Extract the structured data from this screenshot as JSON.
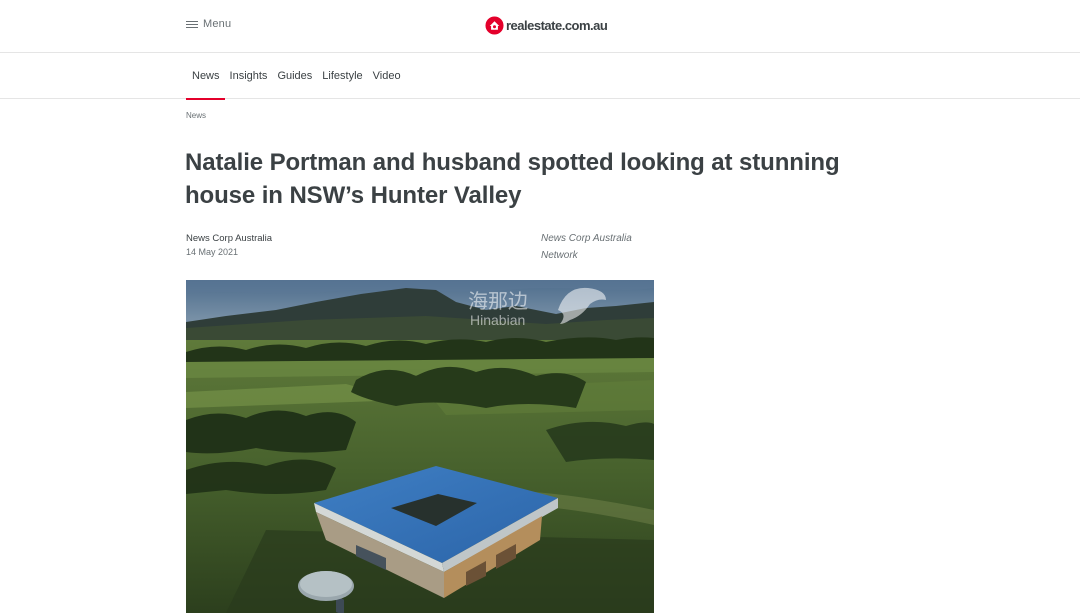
{
  "header": {
    "menu_label": "Menu",
    "logo_text": "realestate.com.au",
    "brand_color": "#e4002b"
  },
  "subnav": {
    "items": [
      {
        "label": "News",
        "active": true
      },
      {
        "label": "Insights",
        "active": false
      },
      {
        "label": "Guides",
        "active": false
      },
      {
        "label": "Lifestyle",
        "active": false
      },
      {
        "label": "Video",
        "active": false
      }
    ]
  },
  "breadcrumb": "News",
  "article": {
    "title": "Natalie Portman and husband spotted looking at stunning house in NSW’s Hunter Valley",
    "author": "News Corp Australia",
    "date": "14 May 2021",
    "network": "News Corp Australia Network"
  },
  "watermark": {
    "chinese": "海那边",
    "latin": "Hinabian"
  }
}
